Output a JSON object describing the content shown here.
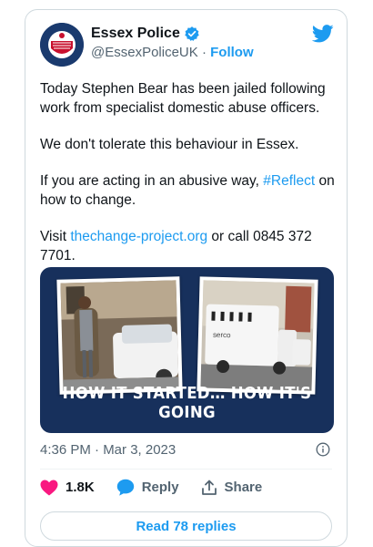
{
  "account": {
    "name": "Essex Police",
    "handle": "@EssexPoliceUK",
    "separator": "·",
    "follow_label": "Follow",
    "avatar_text_top": "ESSEX",
    "avatar_text_bottom": "POLICE"
  },
  "tweet": {
    "p1": "Today Stephen Bear has been jailed following work from specialist domestic abuse officers.",
    "p2": "We don't tolerate this behaviour in Essex.",
    "p3_before": "If you are acting in an abusive way, ",
    "p3_hashtag": "#Reflect",
    "p3_after": " on how to change.",
    "p4_before": "Visit ",
    "p4_link": "thechange-project.org",
    "p4_after": " or call 0845 372 7701."
  },
  "media": {
    "caption": "HOW IT STARTED… HOW IT'S GOING",
    "van_logo": "serco"
  },
  "meta": {
    "timestamp": "4:36 PM · Mar 3, 2023"
  },
  "actions": {
    "likes": "1.8K",
    "reply_label": "Reply",
    "share_label": "Share"
  },
  "footer": {
    "read_replies": "Read 78 replies"
  },
  "colors": {
    "accent": "#1d9bf0",
    "heart": "#f91880",
    "image_bg": "#17305c"
  }
}
